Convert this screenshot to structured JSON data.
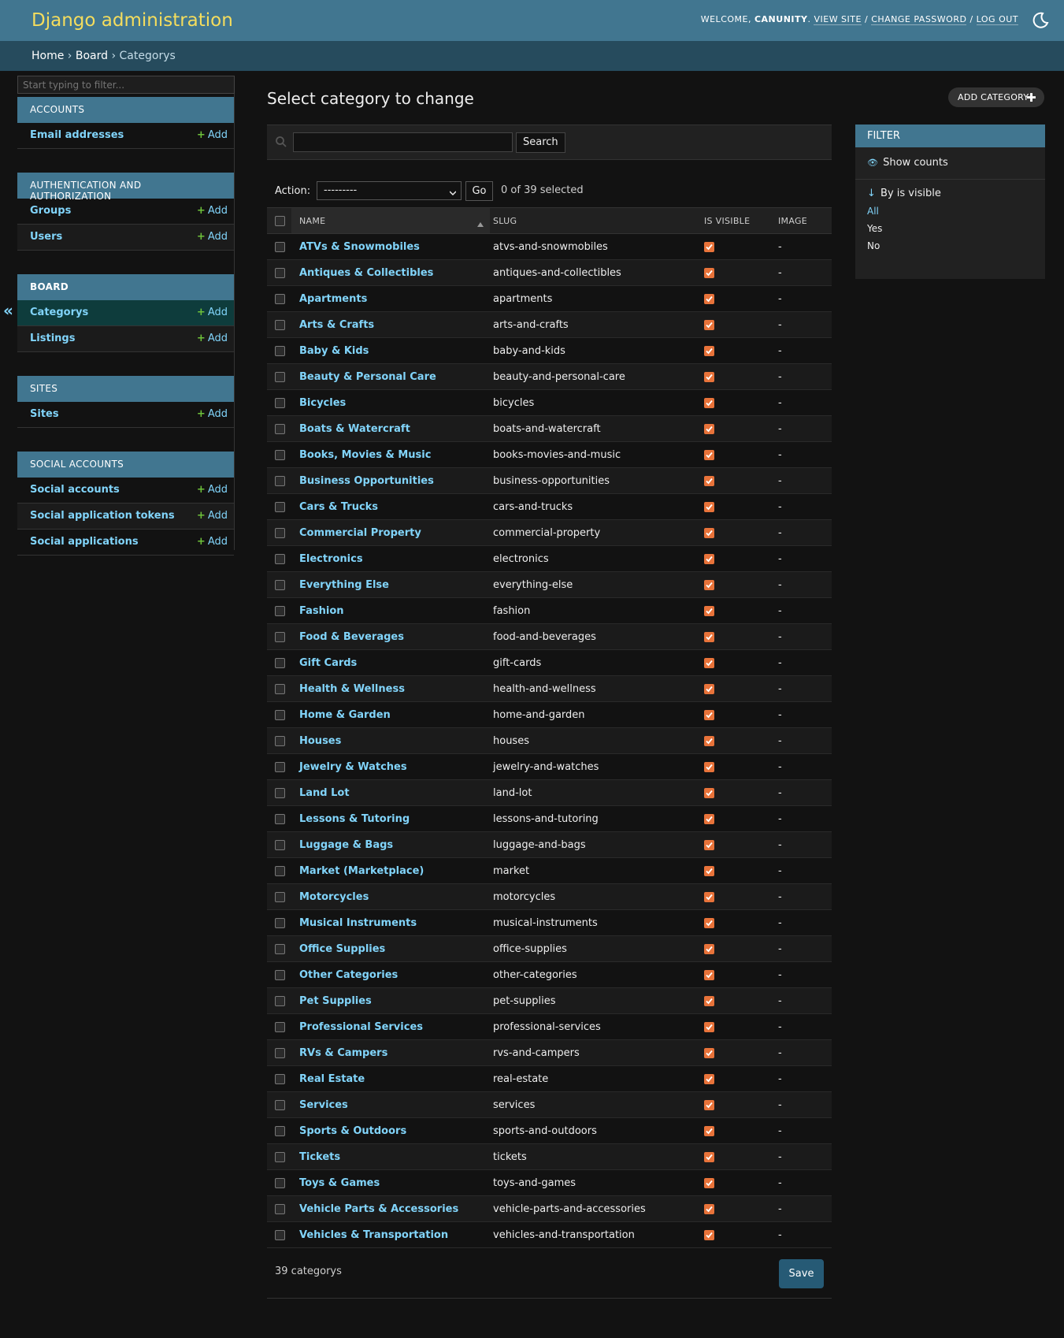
{
  "header": {
    "site_name": "Django administration",
    "welcome": "Welcome,",
    "username": "canunity",
    "view_site": "View site",
    "change_password": "Change password",
    "log_out": "Log out",
    "separator": "/"
  },
  "breadcrumbs": {
    "home": "Home",
    "app": "Board",
    "current": "Categorys",
    "sep": "›"
  },
  "sidebar": {
    "filter_placeholder": "Start typing to filter...",
    "toggle": "«",
    "add_label": "Add",
    "modules": [
      {
        "caption": "Accounts",
        "models": [
          "Email addresses"
        ]
      },
      {
        "caption": "Authentication and Authorization",
        "models": [
          "Groups",
          "Users"
        ]
      },
      {
        "caption": "Board",
        "models": [
          "Categorys",
          "Listings"
        ]
      },
      {
        "caption": "Sites",
        "models": [
          "Sites"
        ]
      },
      {
        "caption": "Social Accounts",
        "models": [
          "Social accounts",
          "Social application tokens",
          "Social applications"
        ]
      }
    ]
  },
  "content": {
    "title": "Select category to change",
    "add_button": "Add category"
  },
  "search": {
    "placeholder": "",
    "button": "Search"
  },
  "actions": {
    "label": "Action:",
    "selected_option": "---------",
    "go": "Go",
    "counter": "0 of 39 selected"
  },
  "table": {
    "headers": {
      "name": "Name",
      "slug": "Slug",
      "is_visible": "Is visible",
      "image": "Image"
    },
    "rows": [
      {
        "name": "ATVs & Snowmobiles",
        "slug": "atvs-and-snowmobiles",
        "image": "-"
      },
      {
        "name": "Antiques & Collectibles",
        "slug": "antiques-and-collectibles",
        "image": "-"
      },
      {
        "name": "Apartments",
        "slug": "apartments",
        "image": "-"
      },
      {
        "name": "Arts & Crafts",
        "slug": "arts-and-crafts",
        "image": "-"
      },
      {
        "name": "Baby & Kids",
        "slug": "baby-and-kids",
        "image": "-"
      },
      {
        "name": "Beauty & Personal Care",
        "slug": "beauty-and-personal-care",
        "image": "-"
      },
      {
        "name": "Bicycles",
        "slug": "bicycles",
        "image": "-"
      },
      {
        "name": "Boats & Watercraft",
        "slug": "boats-and-watercraft",
        "image": "-"
      },
      {
        "name": "Books, Movies & Music",
        "slug": "books-movies-and-music",
        "image": "-"
      },
      {
        "name": "Business Opportunities",
        "slug": "business-opportunities",
        "image": "-"
      },
      {
        "name": "Cars & Trucks",
        "slug": "cars-and-trucks",
        "image": "-"
      },
      {
        "name": "Commercial Property",
        "slug": "commercial-property",
        "image": "-"
      },
      {
        "name": "Electronics",
        "slug": "electronics",
        "image": "-"
      },
      {
        "name": "Everything Else",
        "slug": "everything-else",
        "image": "-"
      },
      {
        "name": "Fashion",
        "slug": "fashion",
        "image": "-"
      },
      {
        "name": "Food & Beverages",
        "slug": "food-and-beverages",
        "image": "-"
      },
      {
        "name": "Gift Cards",
        "slug": "gift-cards",
        "image": "-"
      },
      {
        "name": "Health & Wellness",
        "slug": "health-and-wellness",
        "image": "-"
      },
      {
        "name": "Home & Garden",
        "slug": "home-and-garden",
        "image": "-"
      },
      {
        "name": "Houses",
        "slug": "houses",
        "image": "-"
      },
      {
        "name": "Jewelry & Watches",
        "slug": "jewelry-and-watches",
        "image": "-"
      },
      {
        "name": "Land Lot",
        "slug": "land-lot",
        "image": "-"
      },
      {
        "name": "Lessons & Tutoring",
        "slug": "lessons-and-tutoring",
        "image": "-"
      },
      {
        "name": "Luggage & Bags",
        "slug": "luggage-and-bags",
        "image": "-"
      },
      {
        "name": "Market (Marketplace)",
        "slug": "market",
        "image": "-"
      },
      {
        "name": "Motorcycles",
        "slug": "motorcycles",
        "image": "-"
      },
      {
        "name": "Musical Instruments",
        "slug": "musical-instruments",
        "image": "-"
      },
      {
        "name": "Office Supplies",
        "slug": "office-supplies",
        "image": "-"
      },
      {
        "name": "Other Categories",
        "slug": "other-categories",
        "image": "-"
      },
      {
        "name": "Pet Supplies",
        "slug": "pet-supplies",
        "image": "-"
      },
      {
        "name": "Professional Services",
        "slug": "professional-services",
        "image": "-"
      },
      {
        "name": "RVs & Campers",
        "slug": "rvs-and-campers",
        "image": "-"
      },
      {
        "name": "Real Estate",
        "slug": "real-estate",
        "image": "-"
      },
      {
        "name": "Services",
        "slug": "services",
        "image": "-"
      },
      {
        "name": "Sports & Outdoors",
        "slug": "sports-and-outdoors",
        "image": "-"
      },
      {
        "name": "Tickets",
        "slug": "tickets",
        "image": "-"
      },
      {
        "name": "Toys & Games",
        "slug": "toys-and-games",
        "image": "-"
      },
      {
        "name": "Vehicle Parts & Accessories",
        "slug": "vehicle-parts-and-accessories",
        "image": "-"
      },
      {
        "name": "Vehicles & Transportation",
        "slug": "vehicles-and-transportation",
        "image": "-"
      }
    ]
  },
  "paginator": {
    "text": "39 categorys",
    "save": "Save"
  },
  "filter": {
    "title": "Filter",
    "show_counts": "Show counts",
    "by_label": "By is visible",
    "choices": [
      "All",
      "Yes",
      "No"
    ],
    "selected": "All"
  },
  "colors": {
    "header_bg": "#417690",
    "site_name": "#f5dd5d",
    "breadcrumbs_bg": "#264b5d",
    "link": "#81d4fa",
    "add_plus": "#6ec13a",
    "checkbox_on": "#e8733a",
    "save_bg": "#265a75"
  }
}
